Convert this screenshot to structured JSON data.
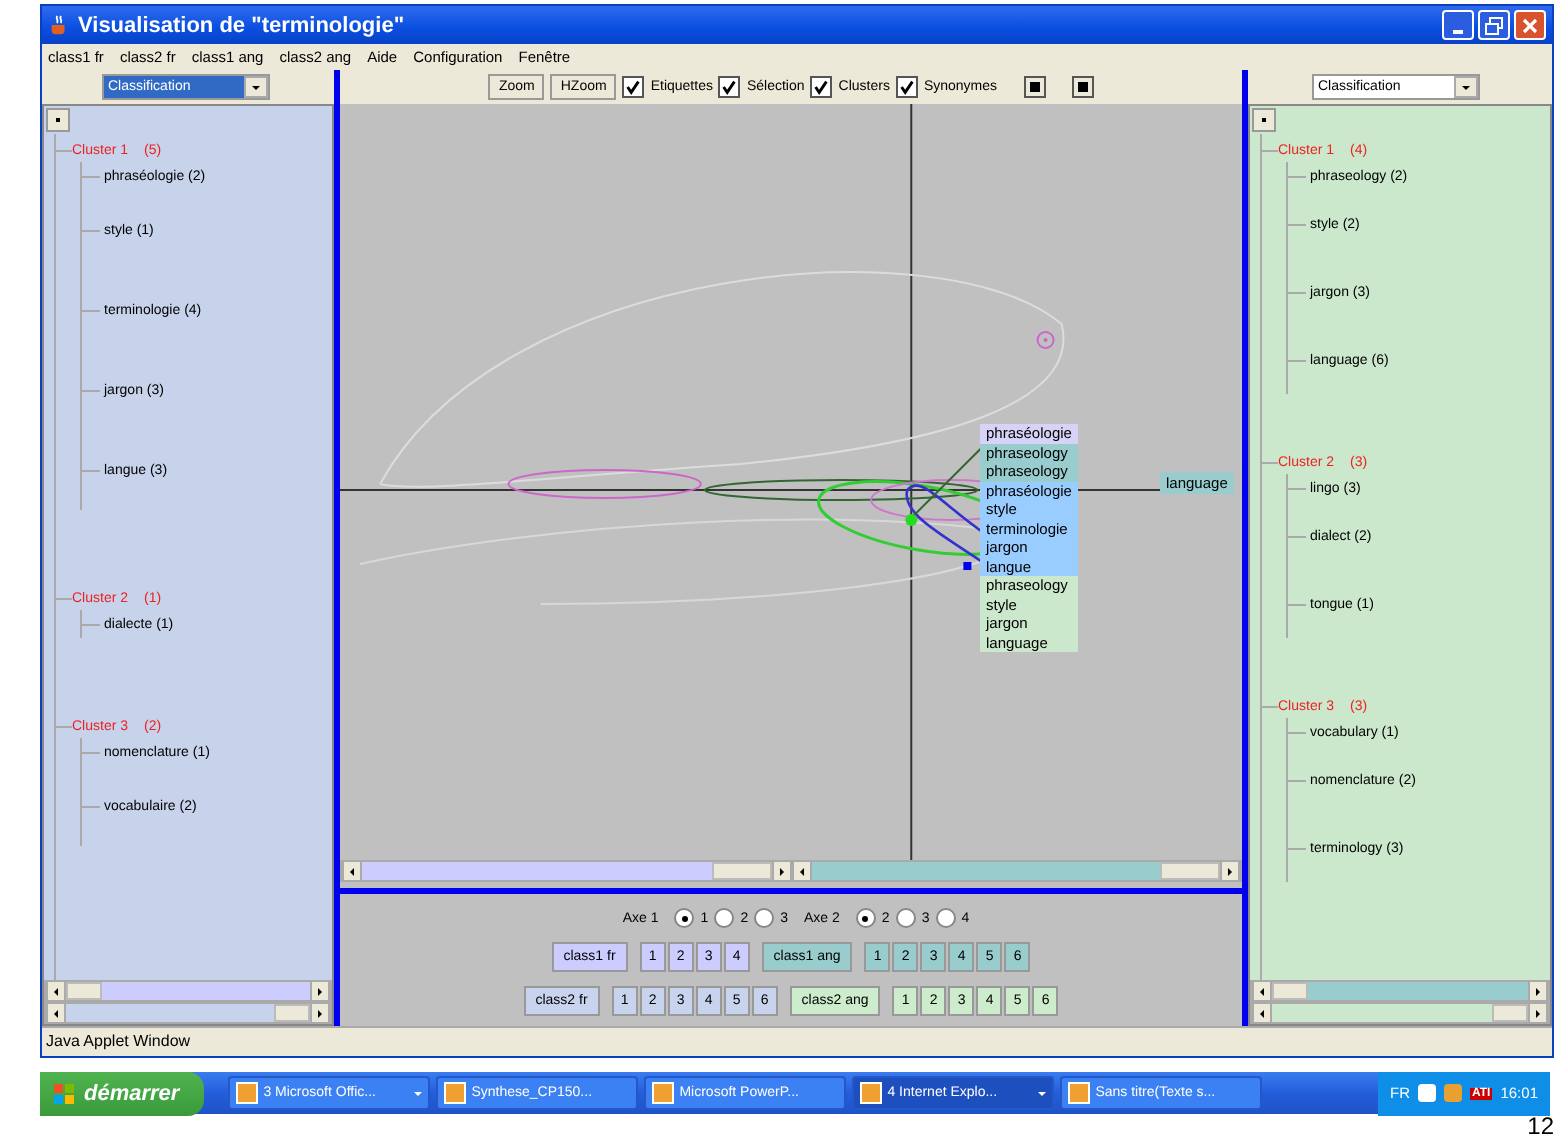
{
  "window": {
    "title": "Visualisation de \"terminologie\""
  },
  "menu": [
    "class1 fr",
    "class2 fr",
    "class1 ang",
    "class2 ang",
    "Aide",
    "Configuration",
    "Fenêtre"
  ],
  "left_panel": {
    "dropdown": "Classification",
    "clusters": [
      {
        "label": "Cluster 1",
        "count": "(5)",
        "children": [
          "phraséologie (2)",
          "style (1)",
          "terminologie (4)",
          "jargon (3)",
          "langue (3)"
        ]
      },
      {
        "label": "Cluster 2",
        "count": "(1)",
        "children": [
          "dialecte (1)"
        ]
      },
      {
        "label": "Cluster 3",
        "count": "(2)",
        "children": [
          "nomenclature (1)",
          "vocabulaire (2)"
        ]
      }
    ]
  },
  "toolbar": {
    "buttons": [
      "Zoom",
      "HZoom"
    ],
    "checkboxes": [
      {
        "label": "Etiquettes",
        "checked": true
      },
      {
        "label": "Sélection",
        "checked": true
      },
      {
        "label": "Clusters",
        "checked": true
      },
      {
        "label": "Synonymes",
        "checked": true
      }
    ]
  },
  "canvas": {
    "popup": [
      {
        "kind": "class1_fr",
        "items": [
          "phraséologie"
        ]
      },
      {
        "kind": "class1_ang",
        "items": [
          "phraseology",
          "phraseology"
        ]
      },
      {
        "kind": "class2_fr",
        "items": [
          "phraséologie",
          "style",
          "terminologie",
          "jargon",
          "langue"
        ]
      },
      {
        "kind": "class2_ang",
        "items": [
          "phraseology",
          "style",
          "jargon",
          "language"
        ]
      }
    ],
    "label": {
      "kind": "class1_ang",
      "text": "language"
    }
  },
  "axes": [
    {
      "label": "Axe 1",
      "options": [
        {
          "label": "1",
          "selected": true
        },
        {
          "label": "2",
          "selected": false
        },
        {
          "label": "3",
          "selected": false
        }
      ]
    },
    {
      "label": "Axe 2",
      "options": [
        {
          "label": "2",
          "selected": true
        },
        {
          "label": "3",
          "selected": false
        },
        {
          "label": "4",
          "selected": false
        }
      ]
    }
  ],
  "class_rows": [
    [
      {
        "kind": "class1_fr",
        "label": "class1 fr",
        "numbers": [
          "1",
          "2",
          "3",
          "4"
        ]
      },
      {
        "kind": "class1_ang",
        "label": "class1 ang",
        "numbers": [
          "1",
          "2",
          "3",
          "4",
          "5",
          "6"
        ]
      }
    ],
    [
      {
        "kind": "class2_fr",
        "label": "class2 fr",
        "numbers": [
          "1",
          "2",
          "3",
          "4",
          "5",
          "6"
        ]
      },
      {
        "kind": "class2_ang",
        "label": "class2 ang",
        "numbers": [
          "1",
          "2",
          "3",
          "4",
          "5",
          "6"
        ]
      }
    ]
  ],
  "right_panel": {
    "dropdown": "Classification",
    "clusters": [
      {
        "label": "Cluster 1",
        "count": "(4)",
        "children": [
          "phraseology (2)",
          "style (2)",
          "jargon (3)",
          "language (6)"
        ]
      },
      {
        "label": "Cluster 2",
        "count": "(3)",
        "children": [
          "lingo (3)",
          "dialect (2)",
          "tongue (1)"
        ]
      },
      {
        "label": "Cluster 3",
        "count": "(3)",
        "children": [
          "vocabulary (1)",
          "nomenclature (2)",
          "terminology (3)"
        ]
      }
    ]
  },
  "status_bar": "Java Applet Window",
  "taskbar": {
    "start": "démarrer",
    "tasks": [
      {
        "label": "3 Microsoft Offic...",
        "selected": false,
        "grouped": true
      },
      {
        "label": "Synthese_CP150...",
        "selected": false,
        "grouped": false
      },
      {
        "label": "Microsoft PowerP...",
        "selected": false,
        "grouped": false
      },
      {
        "label": "4 Internet Explo...",
        "selected": true,
        "grouped": true
      },
      {
        "label": "Sans titre(Texte s...",
        "selected": false,
        "grouped": false
      }
    ],
    "language": "FR",
    "tray_text": "ATI",
    "clock": "16:01"
  },
  "page_number": "12"
}
